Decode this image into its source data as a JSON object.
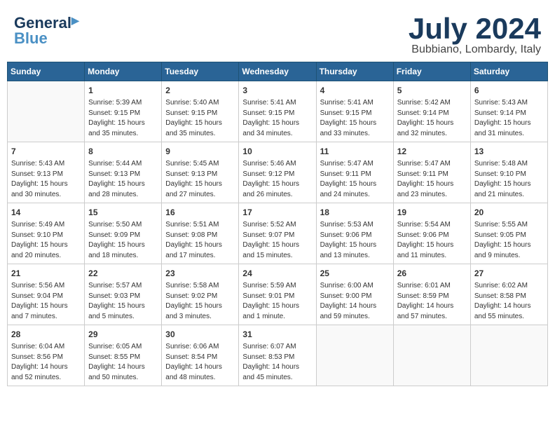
{
  "header": {
    "logo_line1": "General",
    "logo_line2": "Blue",
    "month_year": "July 2024",
    "location": "Bubbiano, Lombardy, Italy"
  },
  "days_of_week": [
    "Sunday",
    "Monday",
    "Tuesday",
    "Wednesday",
    "Thursday",
    "Friday",
    "Saturday"
  ],
  "weeks": [
    [
      {
        "day": "",
        "sunrise": "",
        "sunset": "",
        "daylight": ""
      },
      {
        "day": "1",
        "sunrise": "Sunrise: 5:39 AM",
        "sunset": "Sunset: 9:15 PM",
        "daylight": "Daylight: 15 hours and 35 minutes."
      },
      {
        "day": "2",
        "sunrise": "Sunrise: 5:40 AM",
        "sunset": "Sunset: 9:15 PM",
        "daylight": "Daylight: 15 hours and 35 minutes."
      },
      {
        "day": "3",
        "sunrise": "Sunrise: 5:41 AM",
        "sunset": "Sunset: 9:15 PM",
        "daylight": "Daylight: 15 hours and 34 minutes."
      },
      {
        "day": "4",
        "sunrise": "Sunrise: 5:41 AM",
        "sunset": "Sunset: 9:15 PM",
        "daylight": "Daylight: 15 hours and 33 minutes."
      },
      {
        "day": "5",
        "sunrise": "Sunrise: 5:42 AM",
        "sunset": "Sunset: 9:14 PM",
        "daylight": "Daylight: 15 hours and 32 minutes."
      },
      {
        "day": "6",
        "sunrise": "Sunrise: 5:43 AM",
        "sunset": "Sunset: 9:14 PM",
        "daylight": "Daylight: 15 hours and 31 minutes."
      }
    ],
    [
      {
        "day": "7",
        "sunrise": "Sunrise: 5:43 AM",
        "sunset": "Sunset: 9:13 PM",
        "daylight": "Daylight: 15 hours and 30 minutes."
      },
      {
        "day": "8",
        "sunrise": "Sunrise: 5:44 AM",
        "sunset": "Sunset: 9:13 PM",
        "daylight": "Daylight: 15 hours and 28 minutes."
      },
      {
        "day": "9",
        "sunrise": "Sunrise: 5:45 AM",
        "sunset": "Sunset: 9:13 PM",
        "daylight": "Daylight: 15 hours and 27 minutes."
      },
      {
        "day": "10",
        "sunrise": "Sunrise: 5:46 AM",
        "sunset": "Sunset: 9:12 PM",
        "daylight": "Daylight: 15 hours and 26 minutes."
      },
      {
        "day": "11",
        "sunrise": "Sunrise: 5:47 AM",
        "sunset": "Sunset: 9:11 PM",
        "daylight": "Daylight: 15 hours and 24 minutes."
      },
      {
        "day": "12",
        "sunrise": "Sunrise: 5:47 AM",
        "sunset": "Sunset: 9:11 PM",
        "daylight": "Daylight: 15 hours and 23 minutes."
      },
      {
        "day": "13",
        "sunrise": "Sunrise: 5:48 AM",
        "sunset": "Sunset: 9:10 PM",
        "daylight": "Daylight: 15 hours and 21 minutes."
      }
    ],
    [
      {
        "day": "14",
        "sunrise": "Sunrise: 5:49 AM",
        "sunset": "Sunset: 9:10 PM",
        "daylight": "Daylight: 15 hours and 20 minutes."
      },
      {
        "day": "15",
        "sunrise": "Sunrise: 5:50 AM",
        "sunset": "Sunset: 9:09 PM",
        "daylight": "Daylight: 15 hours and 18 minutes."
      },
      {
        "day": "16",
        "sunrise": "Sunrise: 5:51 AM",
        "sunset": "Sunset: 9:08 PM",
        "daylight": "Daylight: 15 hours and 17 minutes."
      },
      {
        "day": "17",
        "sunrise": "Sunrise: 5:52 AM",
        "sunset": "Sunset: 9:07 PM",
        "daylight": "Daylight: 15 hours and 15 minutes."
      },
      {
        "day": "18",
        "sunrise": "Sunrise: 5:53 AM",
        "sunset": "Sunset: 9:06 PM",
        "daylight": "Daylight: 15 hours and 13 minutes."
      },
      {
        "day": "19",
        "sunrise": "Sunrise: 5:54 AM",
        "sunset": "Sunset: 9:06 PM",
        "daylight": "Daylight: 15 hours and 11 minutes."
      },
      {
        "day": "20",
        "sunrise": "Sunrise: 5:55 AM",
        "sunset": "Sunset: 9:05 PM",
        "daylight": "Daylight: 15 hours and 9 minutes."
      }
    ],
    [
      {
        "day": "21",
        "sunrise": "Sunrise: 5:56 AM",
        "sunset": "Sunset: 9:04 PM",
        "daylight": "Daylight: 15 hours and 7 minutes."
      },
      {
        "day": "22",
        "sunrise": "Sunrise: 5:57 AM",
        "sunset": "Sunset: 9:03 PM",
        "daylight": "Daylight: 15 hours and 5 minutes."
      },
      {
        "day": "23",
        "sunrise": "Sunrise: 5:58 AM",
        "sunset": "Sunset: 9:02 PM",
        "daylight": "Daylight: 15 hours and 3 minutes."
      },
      {
        "day": "24",
        "sunrise": "Sunrise: 5:59 AM",
        "sunset": "Sunset: 9:01 PM",
        "daylight": "Daylight: 15 hours and 1 minute."
      },
      {
        "day": "25",
        "sunrise": "Sunrise: 6:00 AM",
        "sunset": "Sunset: 9:00 PM",
        "daylight": "Daylight: 14 hours and 59 minutes."
      },
      {
        "day": "26",
        "sunrise": "Sunrise: 6:01 AM",
        "sunset": "Sunset: 8:59 PM",
        "daylight": "Daylight: 14 hours and 57 minutes."
      },
      {
        "day": "27",
        "sunrise": "Sunrise: 6:02 AM",
        "sunset": "Sunset: 8:58 PM",
        "daylight": "Daylight: 14 hours and 55 minutes."
      }
    ],
    [
      {
        "day": "28",
        "sunrise": "Sunrise: 6:04 AM",
        "sunset": "Sunset: 8:56 PM",
        "daylight": "Daylight: 14 hours and 52 minutes."
      },
      {
        "day": "29",
        "sunrise": "Sunrise: 6:05 AM",
        "sunset": "Sunset: 8:55 PM",
        "daylight": "Daylight: 14 hours and 50 minutes."
      },
      {
        "day": "30",
        "sunrise": "Sunrise: 6:06 AM",
        "sunset": "Sunset: 8:54 PM",
        "daylight": "Daylight: 14 hours and 48 minutes."
      },
      {
        "day": "31",
        "sunrise": "Sunrise: 6:07 AM",
        "sunset": "Sunset: 8:53 PM",
        "daylight": "Daylight: 14 hours and 45 minutes."
      },
      {
        "day": "",
        "sunrise": "",
        "sunset": "",
        "daylight": ""
      },
      {
        "day": "",
        "sunrise": "",
        "sunset": "",
        "daylight": ""
      },
      {
        "day": "",
        "sunrise": "",
        "sunset": "",
        "daylight": ""
      }
    ]
  ]
}
